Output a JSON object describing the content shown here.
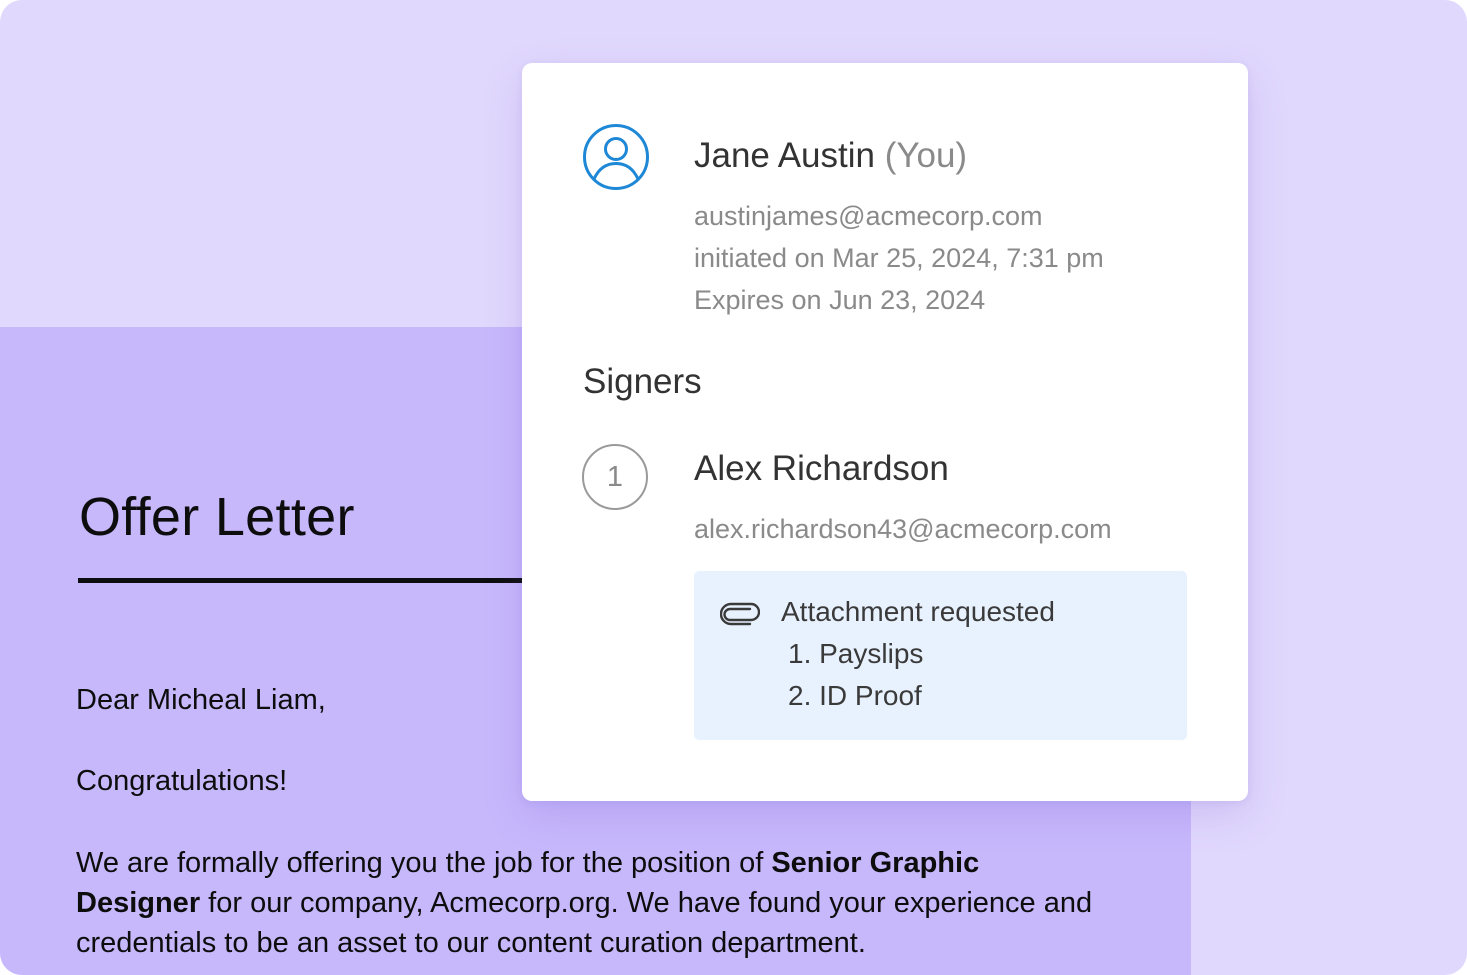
{
  "letter": {
    "title": "Offer Letter",
    "salutation": "Dear Micheal Liam,",
    "congrats": "Congratulations!",
    "body_intro": "We are formally offering you the job for the position of ",
    "body_position": "Senior Graphic Designer",
    "body_rest": " for our company, Acmecorp.org. We have found your experience and credentials to be an asset to our content curation department."
  },
  "owner": {
    "name": "Jane Austin",
    "you_tag": "(You)",
    "email": "austinjames@acmecorp.com",
    "initiated": "initiated on Mar 25, 2024, 7:31 pm",
    "expires": "Expires on Jun 23, 2024",
    "icon": "user-circle-icon"
  },
  "signers": {
    "heading": "Signers",
    "items": [
      {
        "order": "1",
        "name": "Alex Richardson",
        "email": "alex.richardson43@acmecorp.com",
        "attachment": {
          "icon": "paperclip-icon",
          "title": "Attachment requested",
          "items": [
            "1. Payslips",
            "2. ID Proof"
          ]
        }
      }
    ]
  },
  "colors": {
    "background": "#e1d8fd",
    "letter": "#c7b8fc",
    "accent_blue": "#1e88d6",
    "attachment_bg": "#e8f2fe"
  }
}
